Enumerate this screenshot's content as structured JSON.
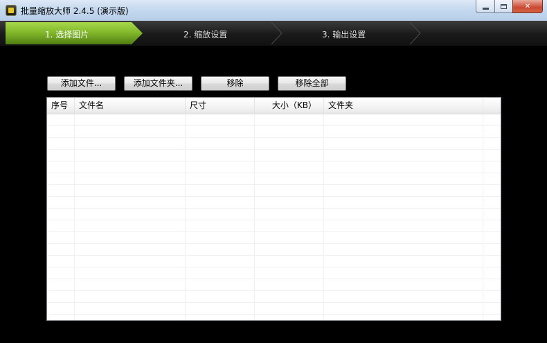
{
  "window": {
    "title": "批量缩放大师 2.4.5 (演示版)",
    "icon": "app-logo-icon"
  },
  "window_controls": {
    "minimize": "minimize-icon",
    "maximize": "maximize-icon",
    "close_label": "✕"
  },
  "steps": [
    {
      "label": "1. 选择图片",
      "active": true
    },
    {
      "label": "2. 缩放设置",
      "active": false
    },
    {
      "label": "3. 输出设置",
      "active": false
    }
  ],
  "toolbar": {
    "add_files": "添加文件...",
    "add_folder": "添加文件夹...",
    "remove": "移除",
    "remove_all": "移除全部"
  },
  "file_list": {
    "columns": [
      "序号",
      "文件名",
      "尺寸",
      "大小（KB）",
      "文件夹"
    ],
    "rows": []
  },
  "colors": {
    "active_step": "#7fb52a",
    "background": "#000000",
    "close_button": "#c94a33"
  }
}
